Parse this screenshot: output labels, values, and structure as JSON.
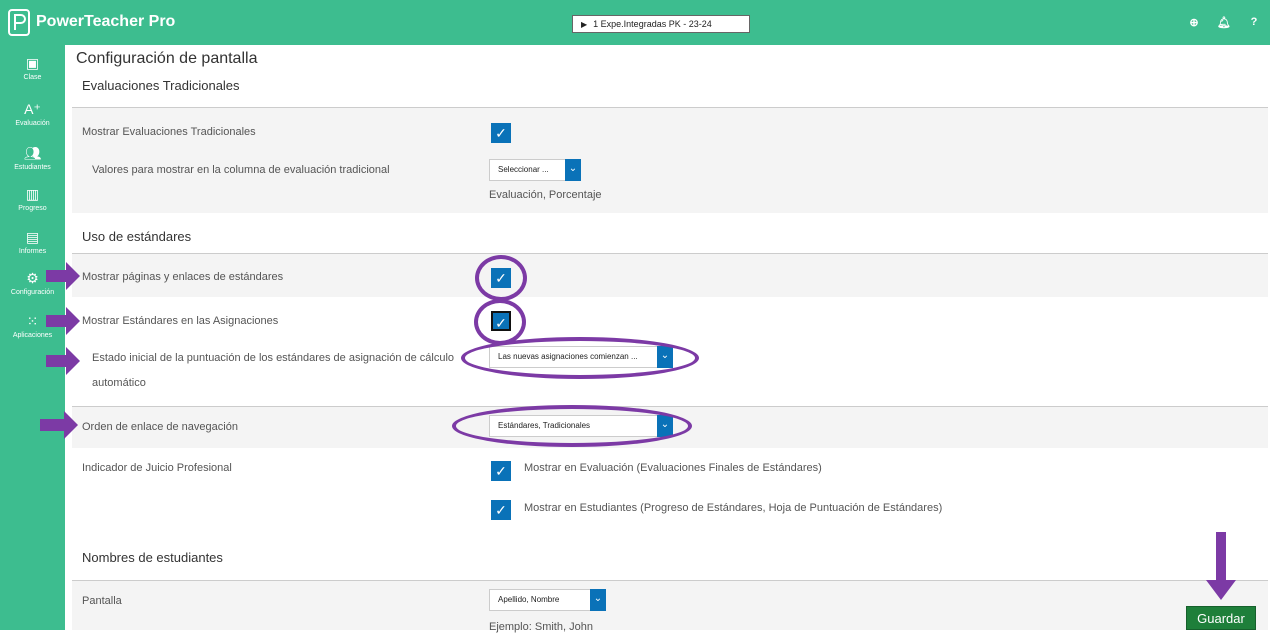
{
  "header": {
    "app_title": "PowerTeacher Pro",
    "class_selector": "1 Expe.Integradas PK - 23-24",
    "icons": [
      "plus-circle-icon",
      "bell-icon",
      "help-icon"
    ]
  },
  "sidebar": {
    "items": [
      {
        "label": "Clase",
        "icon": "roster-icon"
      },
      {
        "label": "Evaluación",
        "icon": "grade-icon"
      },
      {
        "label": "Estudiantes",
        "icon": "students-icon"
      },
      {
        "label": "Progreso",
        "icon": "progress-icon"
      },
      {
        "label": "Informes",
        "icon": "reports-icon"
      },
      {
        "label": "Configuración",
        "icon": "gear-icon"
      },
      {
        "label": "Aplicaciones",
        "icon": "apps-icon"
      }
    ]
  },
  "page": {
    "title": "Configuración de pantalla",
    "traditional": {
      "section_title": "Evaluaciones Tradicionales",
      "show_label": "Mostrar Evaluaciones Tradicionales",
      "values_label": "Valores para mostrar en la columna de evaluación tradicional",
      "values_dropdown": "Seleccionar ...",
      "values_selected": "Evaluación, Porcentaje"
    },
    "standards": {
      "section_title": "Uso de estándares",
      "show_pages_label": "Mostrar páginas y enlaces de estándares",
      "show_in_assignments_label": "Mostrar Estándares en las Asignaciones",
      "initial_state_label_line1": "Estado inicial de la puntuación de los estándares de asignación de cálculo",
      "initial_state_label_line2": "automático",
      "initial_state_dropdown": "Las nuevas asignaciones comienzan ...",
      "nav_order_label": "Orden de enlace de navegación",
      "nav_order_dropdown": "Estándares, Tradicionales",
      "judgment_label": "Indicador de Juicio Profesional",
      "judgment_option1": "Mostrar en Evaluación (Evaluaciones Finales de Estándares)",
      "judgment_option2": "Mostrar en Estudiantes (Progreso de Estándares, Hoja de Puntuación de Estándares)"
    },
    "students": {
      "section_title": "Nombres de estudiantes",
      "display_label": "Pantalla",
      "display_dropdown": "Apellido, Nombre",
      "example": "Ejemplo: Smith, John"
    }
  },
  "actions": {
    "save_label": "Guardar"
  },
  "colors": {
    "header_green": "#3dbd8f",
    "checkbox_blue": "#0a72b8",
    "annotation_purple": "#7c3aa5",
    "save_green": "#1e7f3a"
  }
}
